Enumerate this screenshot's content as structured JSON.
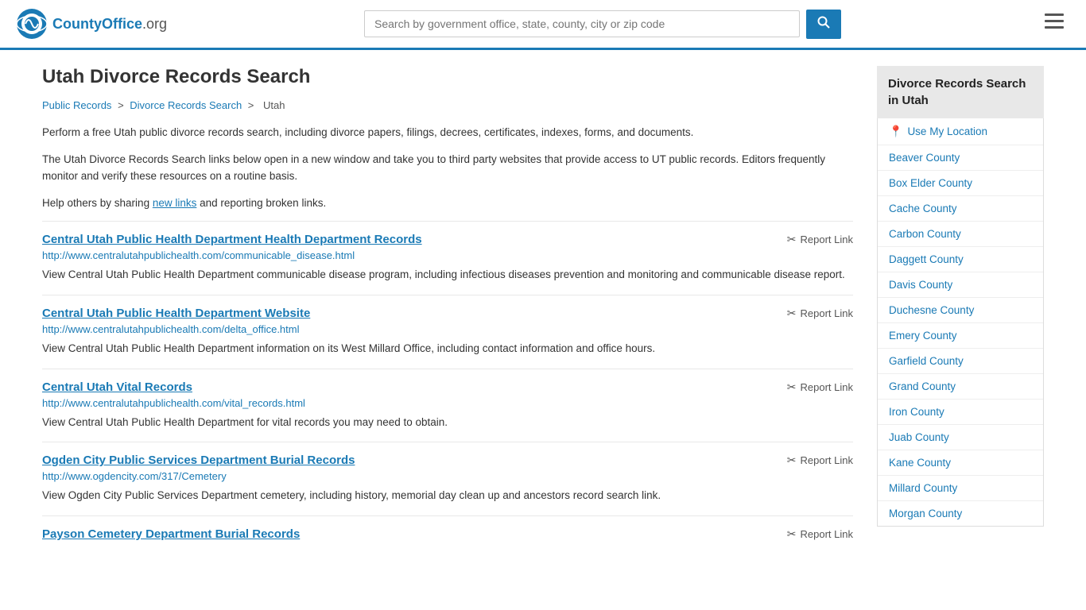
{
  "header": {
    "logo_text": "CountyOffice",
    "logo_suffix": ".org",
    "search_placeholder": "Search by government office, state, county, city or zip code",
    "search_button_label": "🔍"
  },
  "page": {
    "title": "Utah Divorce Records Search",
    "breadcrumb": {
      "items": [
        "Public Records",
        "Divorce Records Search",
        "Utah"
      ]
    },
    "description1": "Perform a free Utah public divorce records search, including divorce papers, filings, decrees, certificates, indexes, forms, and documents.",
    "description2": "The Utah Divorce Records Search links below open in a new window and take you to third party websites that provide access to UT public records. Editors frequently monitor and verify these resources on a routine basis.",
    "description3_prefix": "Help others by sharing ",
    "description3_link": "new links",
    "description3_suffix": " and reporting broken links."
  },
  "results": [
    {
      "title": "Central Utah Public Health Department Health Department Records",
      "url": "http://www.centralutahpublichealth.com/communicable_disease.html",
      "description": "View Central Utah Public Health Department communicable disease program, including infectious diseases prevention and monitoring and communicable disease report."
    },
    {
      "title": "Central Utah Public Health Department Website",
      "url": "http://www.centralutahpublichealth.com/delta_office.html",
      "description": "View Central Utah Public Health Department information on its West Millard Office, including contact information and office hours."
    },
    {
      "title": "Central Utah Vital Records",
      "url": "http://www.centralutahpublichealth.com/vital_records.html",
      "description": "View Central Utah Public Health Department for vital records you may need to obtain."
    },
    {
      "title": "Ogden City Public Services Department Burial Records",
      "url": "http://www.ogdencity.com/317/Cemetery",
      "description": "View Ogden City Public Services Department cemetery, including history, memorial day clean up and ancestors record search link."
    },
    {
      "title": "Payson Cemetery Department Burial Records",
      "url": "",
      "description": ""
    }
  ],
  "report_link_label": "Report Link",
  "sidebar": {
    "title": "Divorce Records Search in Utah",
    "use_my_location": "Use My Location",
    "counties": [
      "Beaver County",
      "Box Elder County",
      "Cache County",
      "Carbon County",
      "Daggett County",
      "Davis County",
      "Duchesne County",
      "Emery County",
      "Garfield County",
      "Grand County",
      "Iron County",
      "Juab County",
      "Kane County",
      "Millard County",
      "Morgan County"
    ]
  }
}
